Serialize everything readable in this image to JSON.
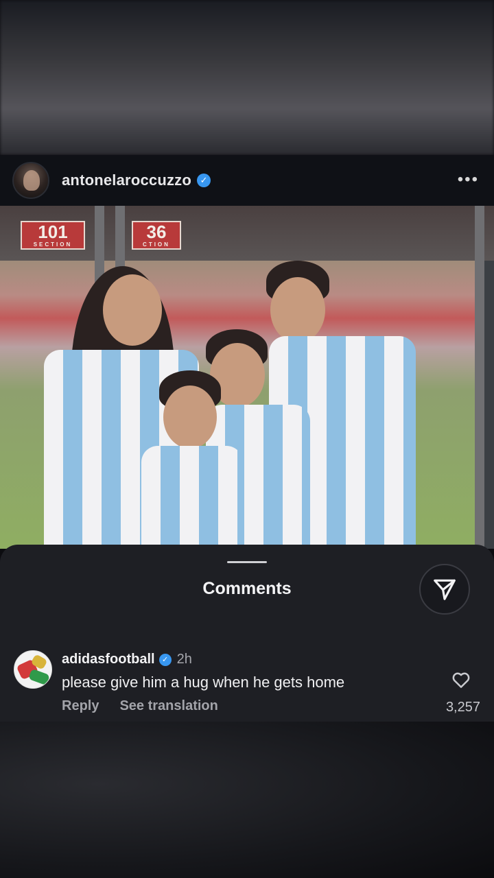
{
  "post": {
    "username": "antonelaroccuzzo",
    "verified": true,
    "more_icon": "more-horizontal-icon",
    "photo_signs": [
      "101",
      "36"
    ],
    "photo_sign_captions": [
      "SECTION",
      "CTION"
    ]
  },
  "comments_sheet": {
    "title": "Comments",
    "share_icon": "send-icon"
  },
  "comment": {
    "username": "adidasfootball",
    "verified": true,
    "time": "2h",
    "text": "please give him a hug when he gets home",
    "reply_label": "Reply",
    "translate_label": "See translation",
    "like_count": "3,257",
    "like_icon": "heart-icon"
  },
  "colors": {
    "verified_badge": "#3897f0",
    "sheet_background": "#1e1f24",
    "header_background": "#0f1116"
  }
}
